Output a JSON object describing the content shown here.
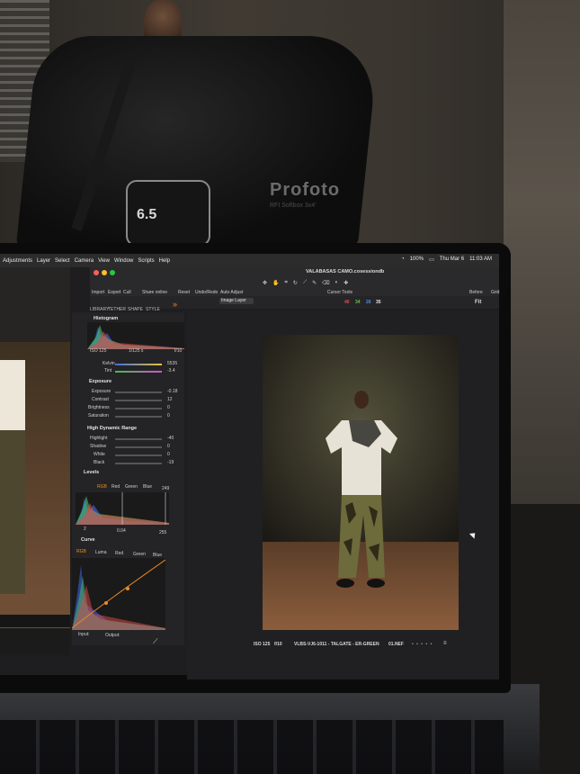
{
  "menubar": {
    "items": [
      "Adjustments",
      "Layer",
      "Select",
      "Camera",
      "View",
      "Window",
      "Scripts",
      "Help"
    ],
    "battery": "100%",
    "date": "Thu Mar 6",
    "time": "11:03 AM"
  },
  "window": {
    "title": "VALABASAS CAMO.cosessiondb"
  },
  "toolbar": {
    "items": [
      "Import",
      "Export",
      "Cull",
      "Share online",
      "Reset",
      "Undo/Redo",
      "Auto Adjust",
      "Cursor Tools",
      "Before",
      "Grid"
    ],
    "tabs": [
      "LIBRARY",
      "TETHER",
      "SHAPE",
      "STYLE"
    ],
    "layer_select": "Image Layer",
    "counts": [
      "40",
      "34",
      "26",
      "35"
    ],
    "count_colors": [
      "#e24b4b",
      "#6fc24a",
      "#4f8fe8",
      "#e8e8e8"
    ],
    "fit_label": "Fit"
  },
  "panel": {
    "histogram": {
      "title": "Histogram",
      "iso": "ISO 125",
      "shutter": "1/125 s",
      "aperture": "f/10"
    },
    "white_balance": {
      "kelvin_label": "Kelvin",
      "kelvin_value": "5535",
      "tint_label": "Tint",
      "tint_value": "-3.4"
    },
    "exposure": {
      "title": "Exposure",
      "rows": [
        {
          "label": "Exposure",
          "value": "-0.18"
        },
        {
          "label": "Contrast",
          "value": "12"
        },
        {
          "label": "Brightness",
          "value": "0"
        },
        {
          "label": "Saturation",
          "value": "0"
        }
      ]
    },
    "hdr": {
      "title": "High Dynamic Range",
      "rows": [
        {
          "label": "Highlight",
          "value": "-40"
        },
        {
          "label": "Shadow",
          "value": "0"
        },
        {
          "label": "White",
          "value": "0"
        },
        {
          "label": "Black",
          "value": "-19"
        }
      ]
    },
    "levels": {
      "title": "Levels",
      "channels": [
        "RGB",
        "Red",
        "Green",
        "Blue"
      ],
      "top_right": "249",
      "low": "2",
      "mid": "0.04",
      "high": "255"
    },
    "curve": {
      "title": "Curve",
      "channels": [
        "RGB",
        "Luma",
        "Red",
        "Green",
        "Blue"
      ],
      "input_label": "Input:",
      "output_label": "Output:"
    }
  },
  "viewer": {
    "iso": "ISO 125",
    "aperture": "f/10",
    "filename": "VLBS-VJ6-1011 - TALGATE - ER-GREEN",
    "file_ext": "01.NEF"
  },
  "scene": {
    "softbox_brand": "Profoto",
    "softbox_sub": "RFI Softbox 3x4'",
    "dial_value": "6.5"
  },
  "colors": {
    "accent": "#f08a24",
    "menubar": "#2d2c2d",
    "panel_bg": "#242426",
    "viewer_bg": "#202022"
  }
}
